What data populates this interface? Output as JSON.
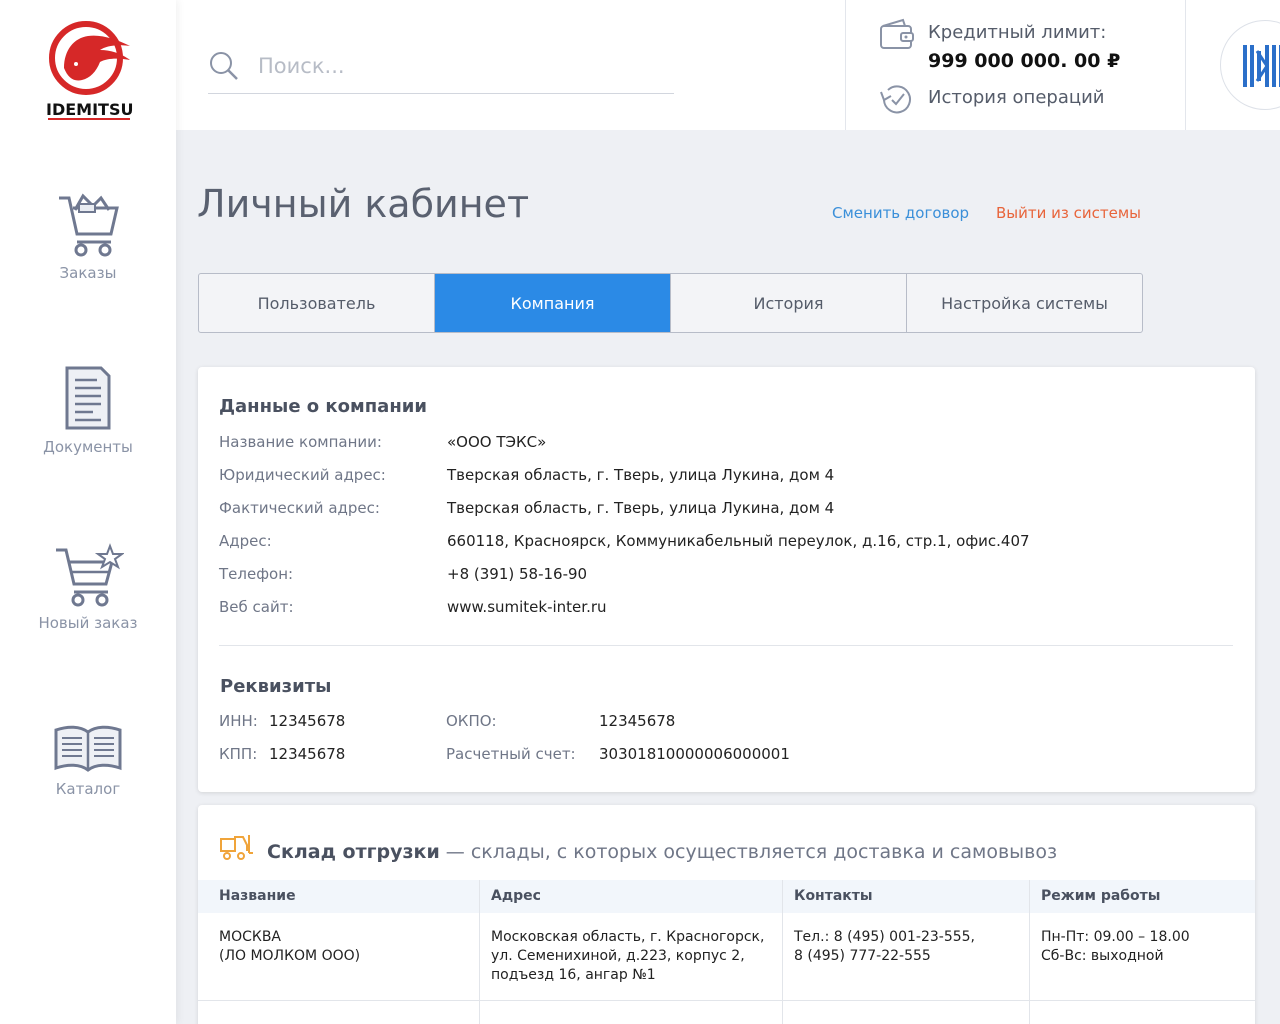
{
  "brand": {
    "logo_text": "IDEMITSU"
  },
  "sidebar": {
    "items": [
      {
        "label": "Заказы",
        "icon": "cart-icon"
      },
      {
        "label": "Документы",
        "icon": "document-icon"
      },
      {
        "label": "Новый заказ",
        "icon": "cart-star-icon"
      },
      {
        "label": "Каталог",
        "icon": "book-icon"
      }
    ]
  },
  "topbar": {
    "search_placeholder": "Поиск...",
    "credit_label": "Кредитный лимит:",
    "credit_value": "999 000 000. 00 ₽",
    "history_label": "История операций"
  },
  "page": {
    "title": "Личный кабинет",
    "switch_contract": "Сменить договор",
    "logout": "Выйти из системы"
  },
  "tabs": [
    {
      "label": "Пользователь",
      "active": false
    },
    {
      "label": "Компания",
      "active": true
    },
    {
      "label": "История",
      "active": false
    },
    {
      "label": "Настройка системы",
      "active": false
    }
  ],
  "company": {
    "title": "Данные о компании",
    "fields": [
      {
        "label": "Название компании:",
        "value": "«ООО ТЭКС»"
      },
      {
        "label": "Юридический адрес:",
        "value": "Тверская область, г. Тверь, улица Лукина, дом 4"
      },
      {
        "label": "Фактический адрес:",
        "value": "Тверская область, г. Тверь, улица Лукина, дом 4"
      },
      {
        "label": "Адрес:",
        "value": "660118, Красноярск, Коммуникабельный переулок, д.16, стр.1, офис.407"
      },
      {
        "label": "Телефон:",
        "value": "+8 (391) 58-16-90"
      },
      {
        "label": "Веб сайт:",
        "value": "www.sumitek-inter.ru"
      }
    ]
  },
  "requisites": {
    "title": "Реквизиты",
    "inn_label": "ИНН:",
    "inn_value": "12345678",
    "kpp_label": "КПП:",
    "kpp_value": "12345678",
    "okpo_label": "ОКПО:",
    "okpo_value": "12345678",
    "account_label": "Расчетный счет:",
    "account_value": "30301810000006000001"
  },
  "warehouse": {
    "title": "Склад отгрузки",
    "subtitle": " — склады, с которых осуществляется доставка и самовывоз",
    "columns": [
      "Название",
      "Адрес",
      "Контакты",
      "Режим работы"
    ],
    "rows": [
      {
        "name": "МОСКВА\n(ЛО МОЛКОМ ООО)",
        "address": "Московская область, г. Красногорск,\nул. Семенихиной, д.223, корпус 2,\nподъезд 16, ангар №1",
        "contacts": "Тел.: 8 (495) 001-23-555,\n8 (495) 777-22-555",
        "hours": "Пн-Пт: 09.00 – 18.00\nСб-Вс: выходной"
      }
    ]
  },
  "colors": {
    "accent": "#2b8ae6",
    "logout": "#e8643a",
    "link": "#3a8fd9",
    "brand_red": "#d62828"
  }
}
